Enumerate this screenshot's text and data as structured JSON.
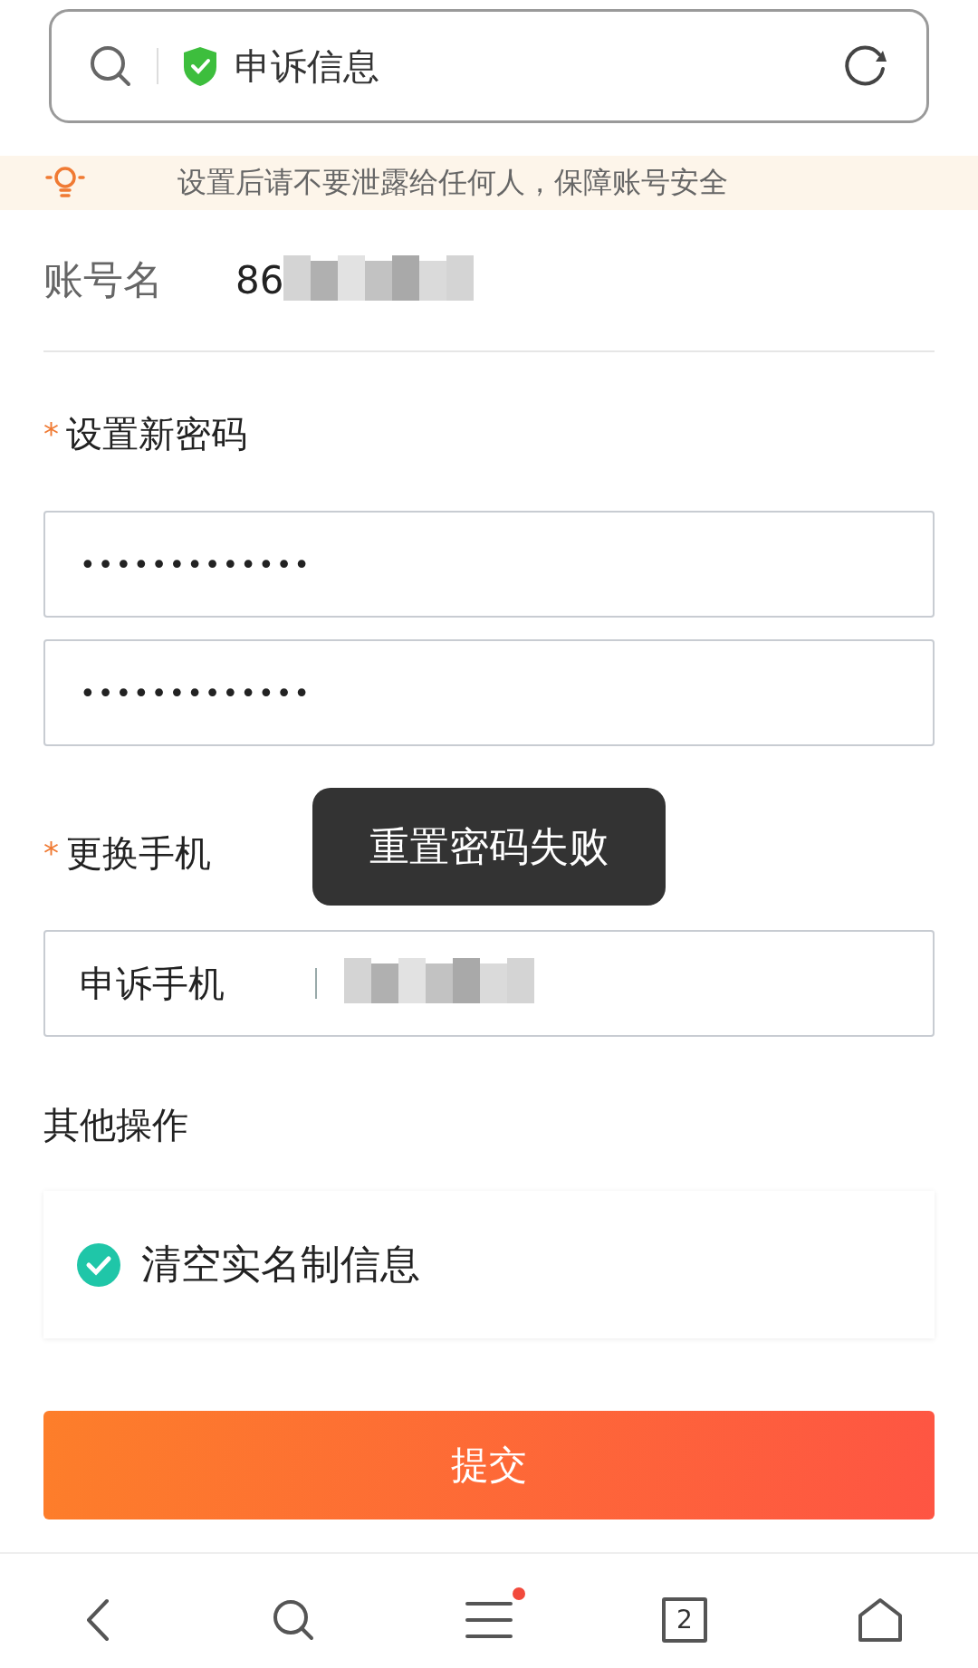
{
  "address_bar": {
    "title": "申诉信息",
    "secure": true
  },
  "notice": {
    "text": "设置后请不要泄露给任何人，保障账号安全"
  },
  "account": {
    "label": "账号名",
    "value": "86",
    "redacted": true
  },
  "new_password": {
    "label": "设置新密码",
    "required": "*",
    "fields": [
      {
        "value": "•••••••••••••"
      },
      {
        "value": "•••••••••••••"
      }
    ]
  },
  "phone": {
    "label": "更换手机",
    "required": "*",
    "field_label": "申诉手机",
    "redacted": true
  },
  "toast": {
    "text": "重置密码失败"
  },
  "other": {
    "title": "其他操作",
    "options": [
      {
        "label": "清空实名制信息",
        "checked": true
      }
    ]
  },
  "submit": {
    "label": "提交"
  },
  "bottom_nav": [
    {
      "kind": "back"
    },
    {
      "kind": "search"
    },
    {
      "kind": "menu",
      "badge": true
    },
    {
      "kind": "tabs",
      "count": "2"
    },
    {
      "kind": "home"
    }
  ]
}
